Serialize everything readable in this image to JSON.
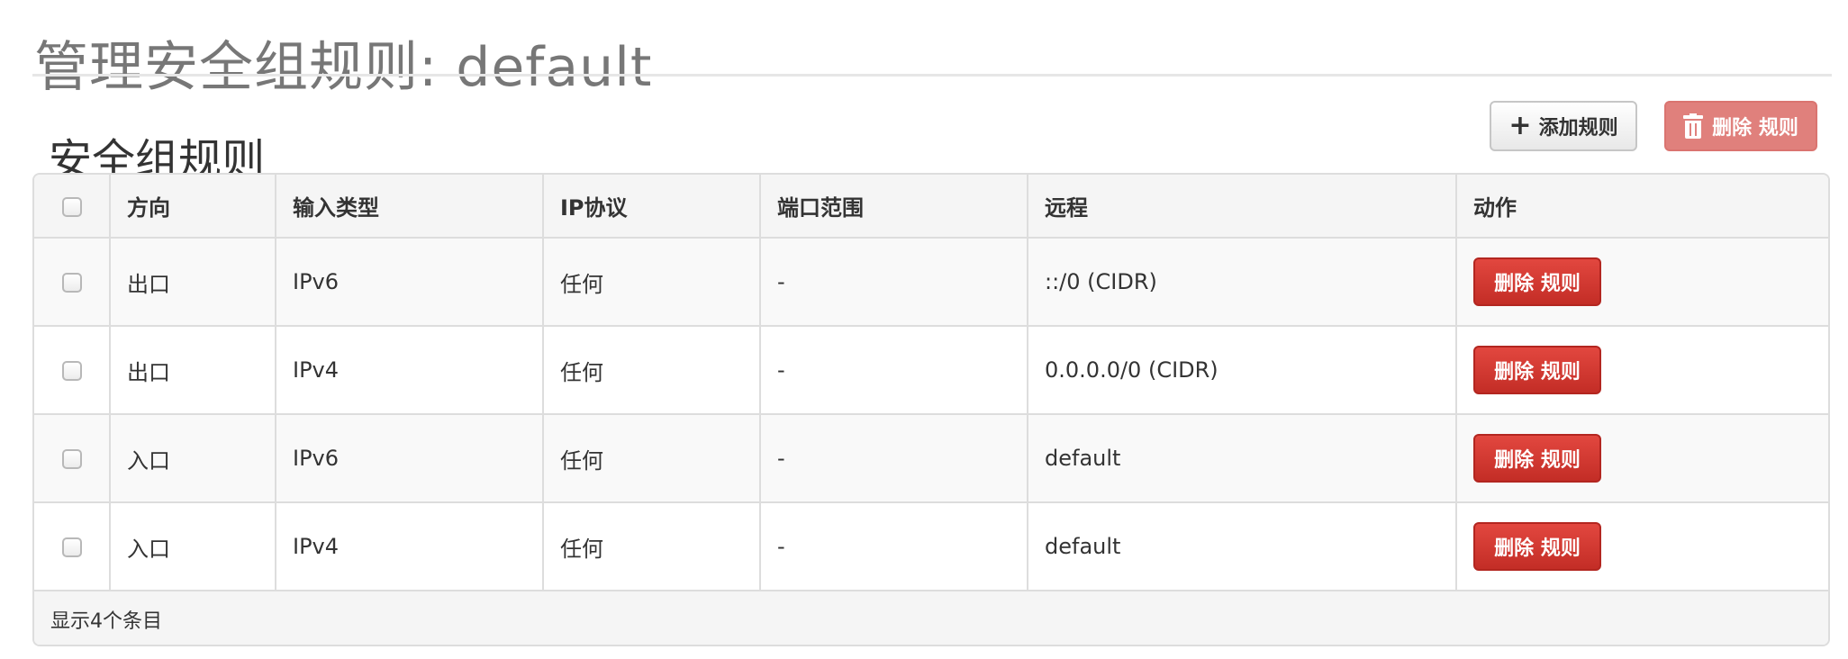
{
  "page": {
    "title": "管理安全组规则: default"
  },
  "section": {
    "title": "安全组规则"
  },
  "toolbar": {
    "add_label": "添加规则",
    "delete_label": "删除 规则",
    "add_icon": "plus-icon",
    "delete_icon": "trash-icon"
  },
  "table": {
    "columns": [
      "方向",
      "输入类型",
      "IP协议",
      "端口范围",
      "远程",
      "动作"
    ],
    "rows": [
      {
        "direction": "出口",
        "ethertype": "IPv6",
        "protocol": "任何",
        "port_range": "-",
        "remote": "::/0 (CIDR)",
        "action": "删除 规则"
      },
      {
        "direction": "出口",
        "ethertype": "IPv4",
        "protocol": "任何",
        "port_range": "-",
        "remote": "0.0.0.0/0 (CIDR)",
        "action": "删除 规则"
      },
      {
        "direction": "入口",
        "ethertype": "IPv6",
        "protocol": "任何",
        "port_range": "-",
        "remote": "default",
        "action": "删除 规则"
      },
      {
        "direction": "入口",
        "ethertype": "IPv4",
        "protocol": "任何",
        "port_range": "-",
        "remote": "default",
        "action": "删除 规则"
      }
    ],
    "footer": "显示4个条目"
  },
  "colors": {
    "danger": "#d9534f",
    "danger_disabled": "#e0807c",
    "border": "#dddddd"
  }
}
